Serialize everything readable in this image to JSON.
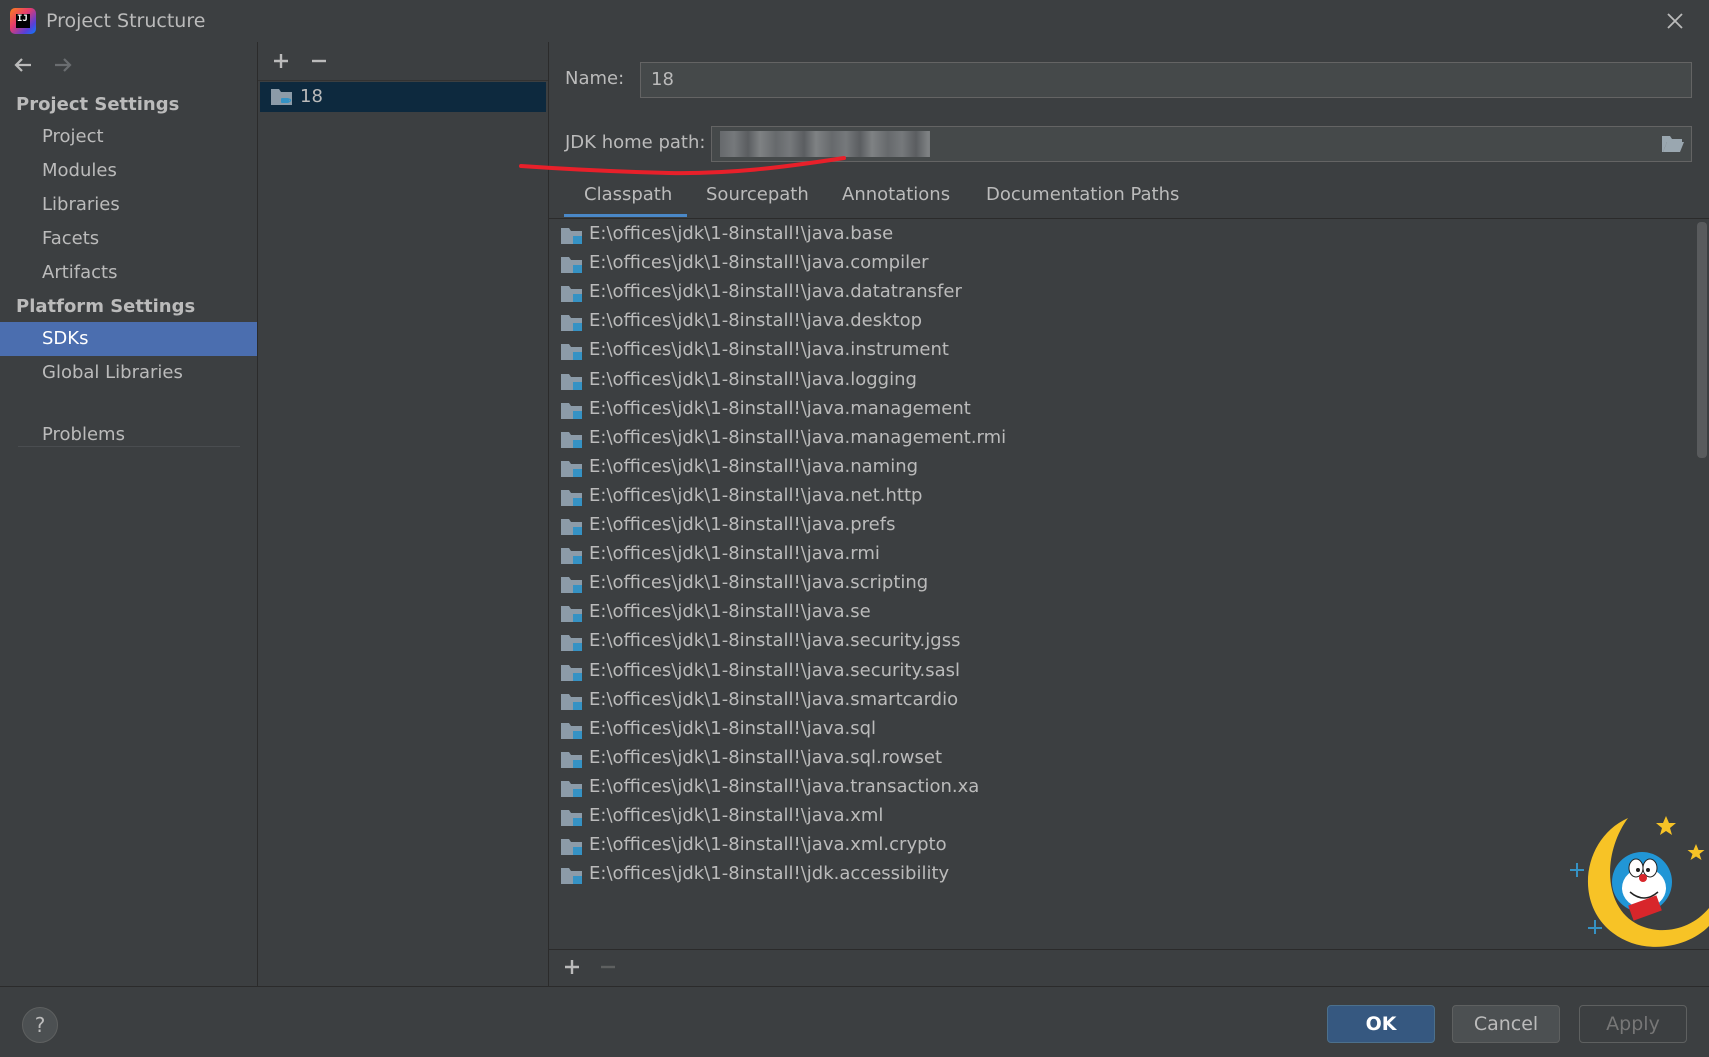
{
  "window": {
    "title": "Project Structure"
  },
  "sidebar": {
    "project_settings_header": "Project Settings",
    "project_items": [
      "Project",
      "Modules",
      "Libraries",
      "Facets",
      "Artifacts"
    ],
    "platform_settings_header": "Platform Settings",
    "platform_items": [
      "SDKs",
      "Global Libraries"
    ],
    "selected": "SDKs",
    "problems": "Problems"
  },
  "sdk_list": {
    "items": [
      "18"
    ]
  },
  "details": {
    "name_label": "Name:",
    "name_value": "18",
    "jdk_home_label": "JDK home path:",
    "tabs": [
      "Classpath",
      "Sourcepath",
      "Annotations",
      "Documentation Paths"
    ],
    "active_tab": "Classpath",
    "classpath": [
      "E:\\offices\\jdk\\1-8install!\\java.base",
      "E:\\offices\\jdk\\1-8install!\\java.compiler",
      "E:\\offices\\jdk\\1-8install!\\java.datatransfer",
      "E:\\offices\\jdk\\1-8install!\\java.desktop",
      "E:\\offices\\jdk\\1-8install!\\java.instrument",
      "E:\\offices\\jdk\\1-8install!\\java.logging",
      "E:\\offices\\jdk\\1-8install!\\java.management",
      "E:\\offices\\jdk\\1-8install!\\java.management.rmi",
      "E:\\offices\\jdk\\1-8install!\\java.naming",
      "E:\\offices\\jdk\\1-8install!\\java.net.http",
      "E:\\offices\\jdk\\1-8install!\\java.prefs",
      "E:\\offices\\jdk\\1-8install!\\java.rmi",
      "E:\\offices\\jdk\\1-8install!\\java.scripting",
      "E:\\offices\\jdk\\1-8install!\\java.se",
      "E:\\offices\\jdk\\1-8install!\\java.security.jgss",
      "E:\\offices\\jdk\\1-8install!\\java.security.sasl",
      "E:\\offices\\jdk\\1-8install!\\java.smartcardio",
      "E:\\offices\\jdk\\1-8install!\\java.sql",
      "E:\\offices\\jdk\\1-8install!\\java.sql.rowset",
      "E:\\offices\\jdk\\1-8install!\\java.transaction.xa",
      "E:\\offices\\jdk\\1-8install!\\java.xml",
      "E:\\offices\\jdk\\1-8install!\\java.xml.crypto",
      "E:\\offices\\jdk\\1-8install!\\jdk.accessibility"
    ]
  },
  "buttons": {
    "help": "?",
    "ok": "OK",
    "cancel": "Cancel",
    "apply": "Apply"
  },
  "colors": {
    "accent": "#4b6eaf",
    "ok_button": "#365880",
    "annotation_red": "#e8202a"
  }
}
